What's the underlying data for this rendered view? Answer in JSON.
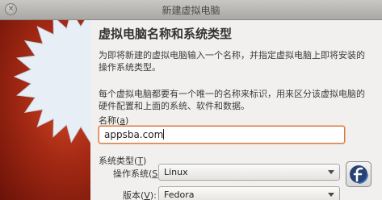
{
  "window": {
    "title": "新建虚拟电脑",
    "close_glyph": "×"
  },
  "page": {
    "heading": "虚拟电脑名称和系统类型",
    "description1": "为即将新建的虚拟电脑输入一个名称，并指定虚拟电脑上即将安装的操作系统类型。",
    "description2": "每个虚拟电脑都要有一个唯一的名称来标识，用来区分该虚拟电脑的硬件配置和上面的系统、软件和数据。"
  },
  "name": {
    "label": "名称",
    "mnemonic": "a",
    "value": "appsba.com"
  },
  "os_type": {
    "group_label": "系统类型",
    "group_mnemonic": "T",
    "os_label": "操作系统",
    "os_mnemonic": "S",
    "os_value": "Linux",
    "version_label": "版本",
    "version_mnemonic": "V",
    "version_value": "Fedora",
    "logo_icon": "fedora-logo-icon"
  },
  "colors": {
    "accent": "#d07a45",
    "art_red": "#a52a14",
    "fedora_blue": "#294172"
  }
}
